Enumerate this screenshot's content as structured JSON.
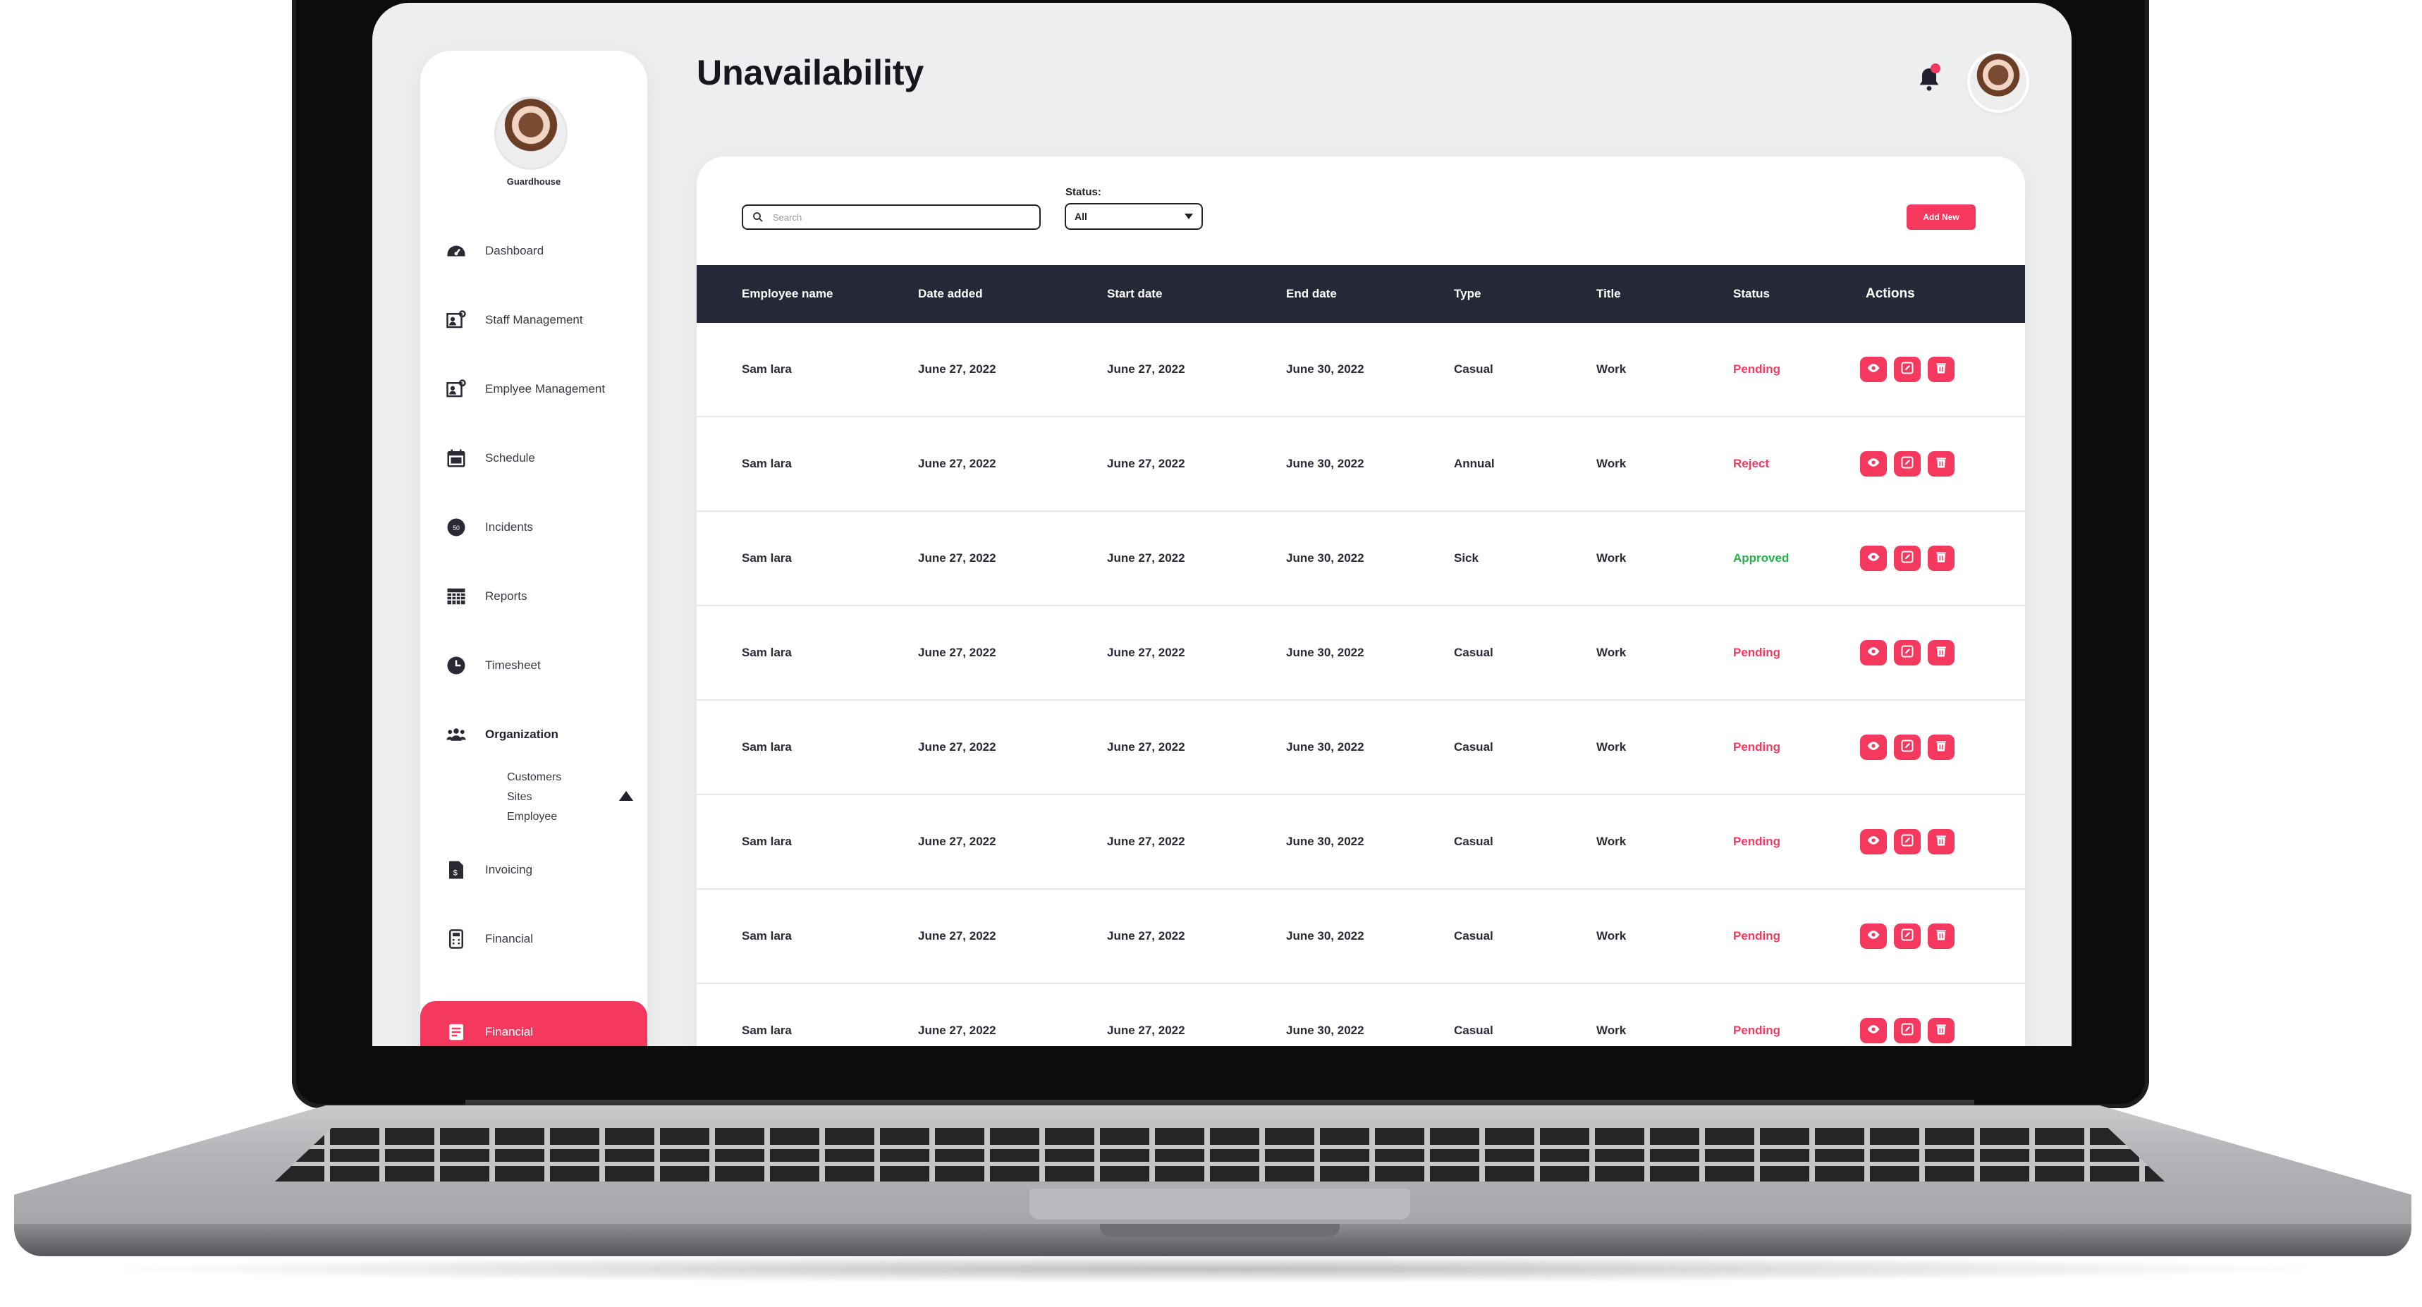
{
  "page": {
    "title": "Unavailability"
  },
  "sidebar": {
    "user_name": "Guardhouse",
    "items": [
      {
        "label": "Dashboard",
        "icon": "dashboard-gauge-icon"
      },
      {
        "label": "Staff Management",
        "icon": "staff-id-card-icon"
      },
      {
        "label": "Emplyee Management",
        "icon": "employee-id-card-icon"
      },
      {
        "label": "Schedule",
        "icon": "calendar-icon"
      },
      {
        "label": "Incidents",
        "icon": "incidents-badge-icon",
        "badge": "50"
      },
      {
        "label": "Reports",
        "icon": "reports-grid-icon"
      },
      {
        "label": "Timesheet",
        "icon": "clock-icon"
      },
      {
        "label": "Organization",
        "icon": "group-people-icon",
        "expanded": true,
        "children": [
          "Customers",
          "Sites",
          "Employee"
        ]
      },
      {
        "label": "Invoicing",
        "icon": "invoice-icon"
      },
      {
        "label": "Financial",
        "icon": "calculator-icon"
      },
      {
        "label": "Financial",
        "icon": "financial-card-icon",
        "active": true
      }
    ]
  },
  "header": {
    "notification_icon": "bell-icon",
    "avatar": "user-avatar"
  },
  "filters": {
    "search_placeholder": "Search",
    "status_label": "Status:",
    "status_value": "All",
    "add_button": "Add New"
  },
  "table": {
    "columns": [
      "Employee name",
      "Date added",
      "Start date",
      "End date",
      "Type",
      "Title",
      "Status",
      "Actions"
    ],
    "rows": [
      {
        "name": "Sam lara",
        "added": "June 27, 2022",
        "start": "June 27, 2022",
        "end": "June 30, 2022",
        "type": "Casual",
        "title": "Work",
        "status": "Pending"
      },
      {
        "name": "Sam lara",
        "added": "June 27, 2022",
        "start": "June 27, 2022",
        "end": "June 30, 2022",
        "type": "Annual",
        "title": "Work",
        "status": "Reject"
      },
      {
        "name": "Sam lara",
        "added": "June 27, 2022",
        "start": "June 27, 2022",
        "end": "June 30, 2022",
        "type": "Sick",
        "title": "Work",
        "status": "Approved"
      },
      {
        "name": "Sam lara",
        "added": "June 27, 2022",
        "start": "June 27, 2022",
        "end": "June 30, 2022",
        "type": "Casual",
        "title": "Work",
        "status": "Pending"
      },
      {
        "name": "Sam lara",
        "added": "June 27, 2022",
        "start": "June 27, 2022",
        "end": "June 30, 2022",
        "type": "Casual",
        "title": "Work",
        "status": "Pending"
      },
      {
        "name": "Sam lara",
        "added": "June 27, 2022",
        "start": "June 27, 2022",
        "end": "June 30, 2022",
        "type": "Casual",
        "title": "Work",
        "status": "Pending"
      },
      {
        "name": "Sam lara",
        "added": "June 27, 2022",
        "start": "June 27, 2022",
        "end": "June 30, 2022",
        "type": "Casual",
        "title": "Work",
        "status": "Pending"
      },
      {
        "name": "Sam lara",
        "added": "June 27, 2022",
        "start": "June 27, 2022",
        "end": "June 30, 2022",
        "type": "Casual",
        "title": "Work",
        "status": "Pending"
      }
    ],
    "action_icons": [
      "view-eye-icon",
      "edit-icon",
      "delete-trash-icon"
    ]
  },
  "colors": {
    "accent": "#f4385e",
    "header_bg": "#252836",
    "approved": "#27b34a",
    "screen_bg": "#edeef0"
  }
}
